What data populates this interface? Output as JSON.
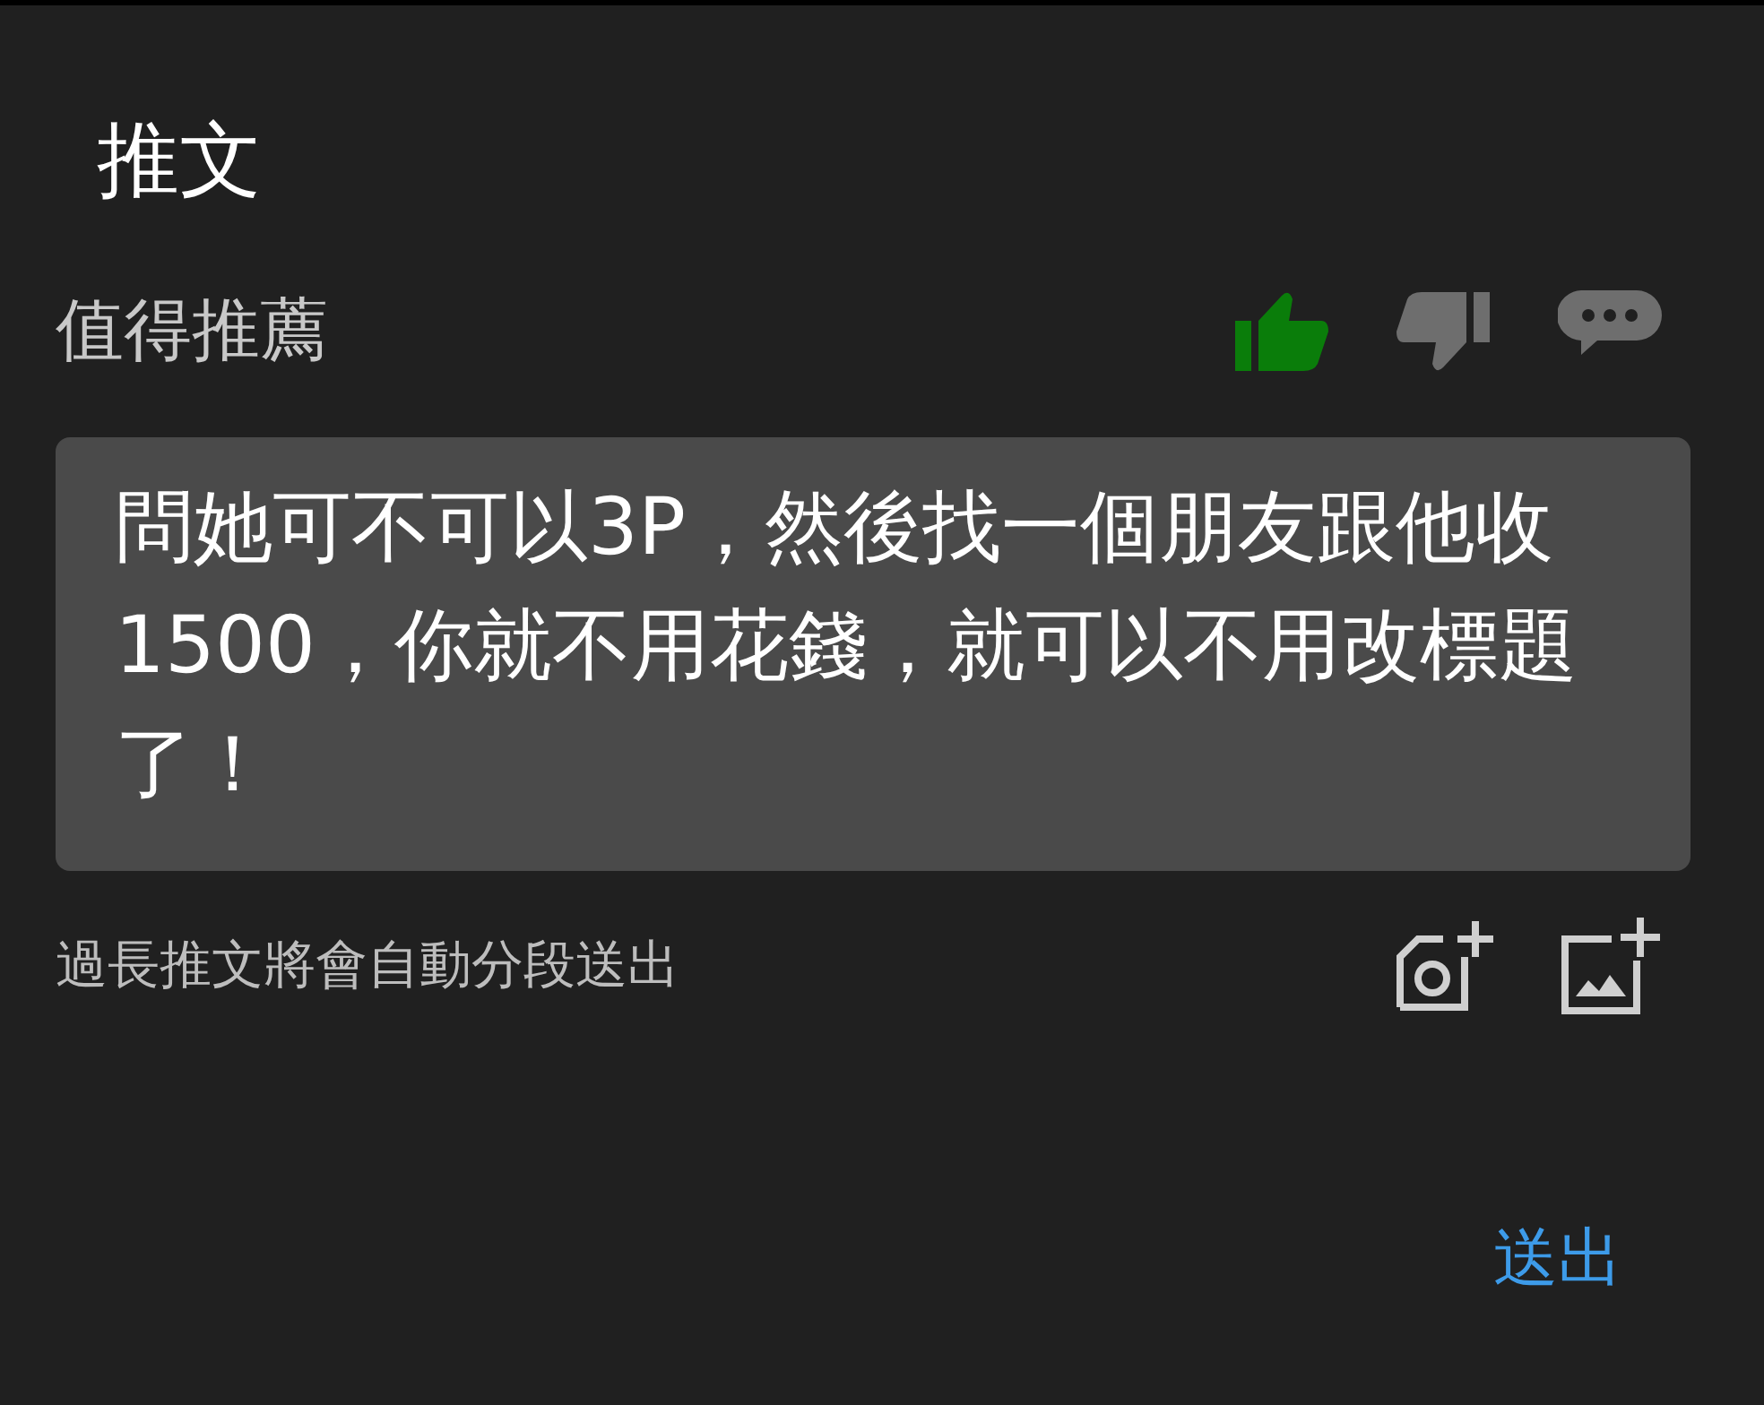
{
  "dialog": {
    "title": "推文"
  },
  "rating": {
    "label": "值得推薦",
    "options": [
      {
        "kind": "like",
        "selected": true
      },
      {
        "kind": "dislike",
        "selected": false
      },
      {
        "kind": "comment",
        "selected": false
      }
    ]
  },
  "comment": {
    "value": "問她可不可以3P，然後找一個朋友跟他收1500，你就不用花錢，就可以不用改標題了！"
  },
  "hint": "過長推文將會自動分段送出",
  "attachments": [
    {
      "kind": "camera"
    },
    {
      "kind": "image"
    }
  ],
  "actions": [
    "送出"
  ]
}
